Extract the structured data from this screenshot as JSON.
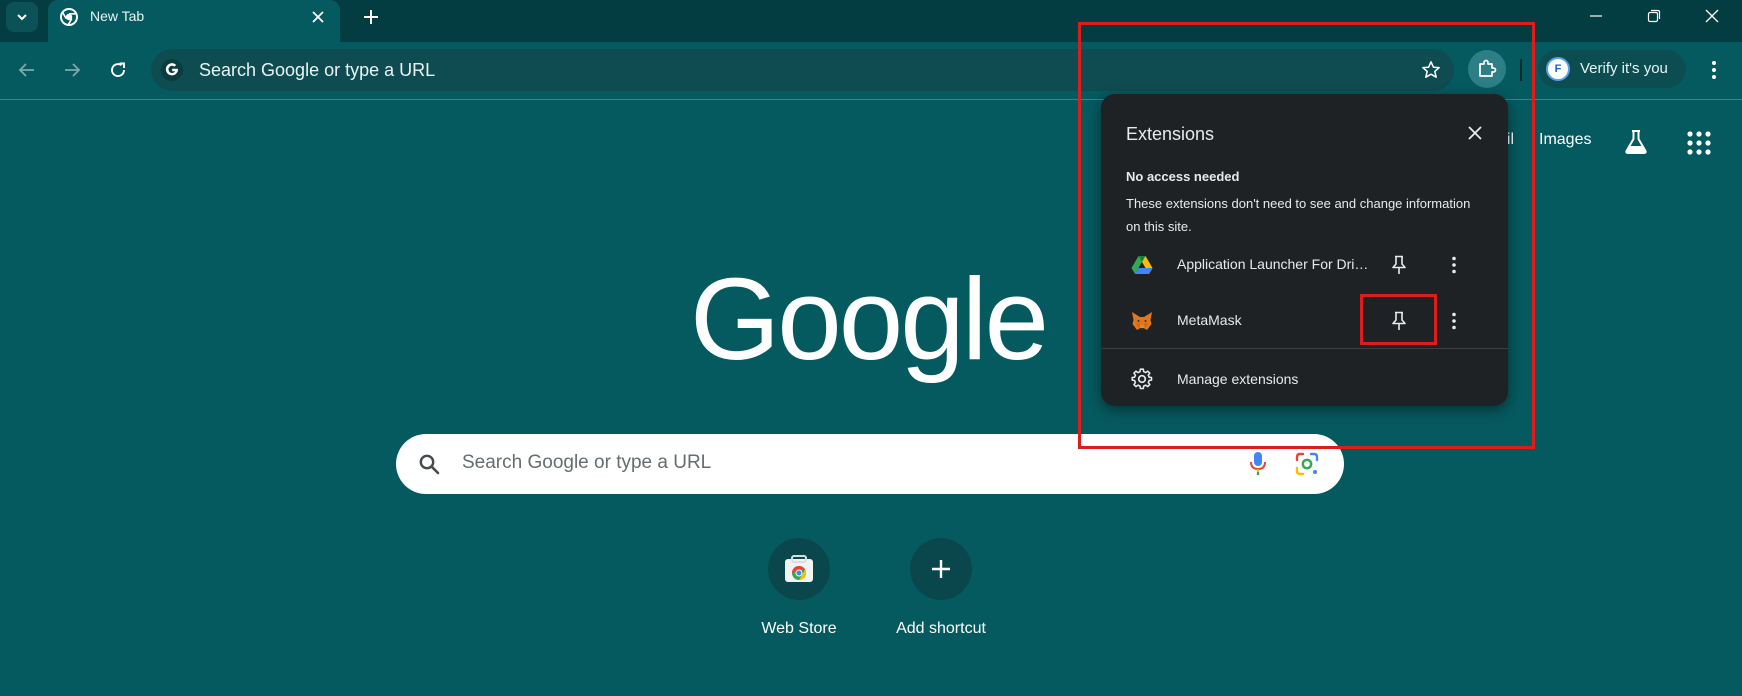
{
  "browser": {
    "tab": {
      "title": "New Tab"
    },
    "omnibox": {
      "placeholder": "Search Google or type a URL"
    },
    "profile": {
      "initial": "F",
      "label": "Verify it's you"
    }
  },
  "ntp": {
    "top_links": {
      "gmail": "ail",
      "images": "Images"
    },
    "logo_text": "Google",
    "search": {
      "placeholder": "Search Google or type a URL"
    },
    "shortcuts": [
      {
        "label": "Web Store"
      },
      {
        "label": "Add shortcut"
      }
    ]
  },
  "extensions_popup": {
    "title": "Extensions",
    "section_heading": "No access needed",
    "section_description": "These extensions don't need to see and change information on this site.",
    "items": [
      {
        "name": "Application Launcher For Drive (by Google)",
        "icon": "google-drive-icon"
      },
      {
        "name": "MetaMask",
        "icon": "metamask-fox-icon"
      }
    ],
    "manage_label": "Manage extensions"
  },
  "colors": {
    "page_background": "#055a60",
    "titlebar": "#033d42",
    "popup_background": "#1f2224",
    "annotation": "#dd1c1c"
  }
}
